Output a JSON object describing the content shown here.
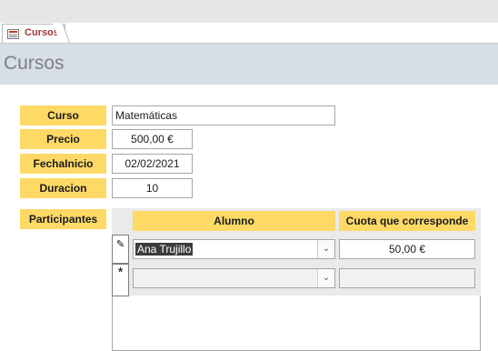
{
  "tab": {
    "label": "Cursos"
  },
  "header": {
    "title": "Cursos"
  },
  "form": {
    "curso": {
      "label": "Curso",
      "value": "Matemáticas"
    },
    "precio": {
      "label": "Precio",
      "value": "500,00 €"
    },
    "fecha": {
      "label": "FechaInicio",
      "value": "02/02/2021"
    },
    "duracion": {
      "label": "Duracion",
      "value": "10"
    }
  },
  "participantes": {
    "label": "Participantes",
    "columns": [
      "Alumno",
      "Cuota que corresponde"
    ],
    "rows": [
      {
        "alumno": "Ana Trujillo",
        "cuota": "50,00 €"
      }
    ],
    "row_marker_edit": "✎",
    "row_marker_new": "*"
  },
  "icons": [
    "form-icon",
    "pencil-icon",
    "new-record-icon",
    "chevron-down-icon"
  ]
}
